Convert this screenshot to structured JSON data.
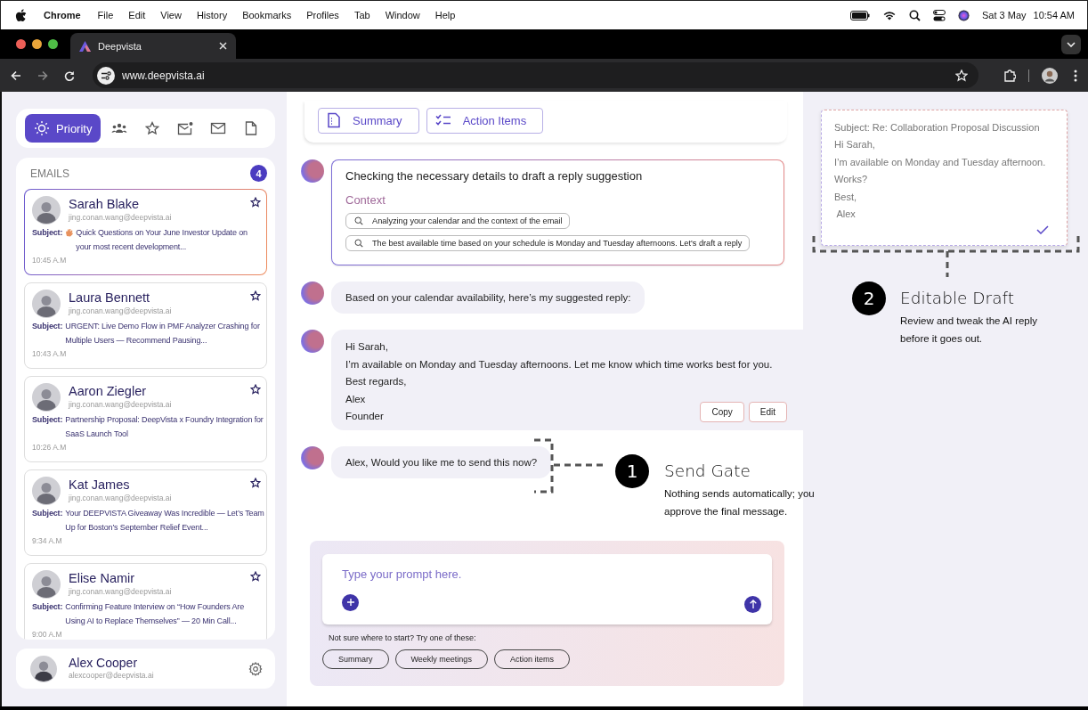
{
  "menu_bar": {
    "app": "Chrome",
    "items": [
      "File",
      "Edit",
      "View",
      "History",
      "Bookmarks",
      "Profiles",
      "Tab",
      "Window",
      "Help"
    ],
    "date": "Sat 3 May",
    "time": "10:54 AM"
  },
  "browser": {
    "tab_title": "Deepvista",
    "url": "www.deepvista.ai"
  },
  "sidebar": {
    "filters": [
      {
        "kind": "priority",
        "label": "Priority",
        "selected": true
      },
      {
        "kind": "people",
        "selected": false
      },
      {
        "kind": "star",
        "selected": false
      },
      {
        "kind": "mail_dot",
        "selected": false
      },
      {
        "kind": "mail",
        "selected": false
      },
      {
        "kind": "document",
        "selected": false
      }
    ],
    "emails_title": "EMAILS",
    "emails_count": "4",
    "emails": [
      {
        "name": "Sarah Blake",
        "address": "jing.conan.wang@deepvista.ai",
        "wave_emoji": true,
        "subject_label": "Subject:",
        "subject": "Quick Questions on Your June Investor Update on your most recent development...",
        "time": "10:45 A.M",
        "selected": true
      },
      {
        "name": "Laura Bennett",
        "address": "jing.conan.wang@deepvista.ai",
        "subject_label": "Subject:",
        "subject": "URGENT: Live Demo Flow in PMF Analyzer Crashing for Multiple Users — Recommend Pausing...",
        "time": "10:43 A.M",
        "selected": false
      },
      {
        "name": "Aaron Ziegler",
        "address": "jing.conan.wang@deepvista.ai",
        "subject_label": "Subject:",
        "subject": "Partnership Proposal: DeepVista x Foundry Integration for SaaS Launch Tool",
        "time": "10:26 A.M",
        "selected": false
      },
      {
        "name": "Kat James",
        "address": "jing.conan.wang@deepvista.ai",
        "subject_label": "Subject:",
        "subject": "Your DEEPVISTA Giveaway Was Incredible — Let’s Team Up for Boston’s September Relief Event...",
        "time": "9:34 A.M",
        "selected": false
      },
      {
        "name": "Elise Namir",
        "address": "jing.conan.wang@deepvista.ai",
        "subject_label": "Subject:",
        "subject": "Confirming Feature Interview on “How Founders Are Using AI to Replace Themselves” — 20 Min Call...",
        "time": "9:00 A.M",
        "selected": false
      }
    ],
    "user": {
      "name": "Alex Cooper",
      "address": "alexcooper@deepvista.ai"
    }
  },
  "quick_actions": [
    {
      "kind": "summary",
      "label": "Summary"
    },
    {
      "kind": "action_items",
      "label": "Action Items"
    }
  ],
  "messages": [
    {
      "kind": "context",
      "title": "Checking the necessary details to draft a reply suggestion",
      "context_label": "Context",
      "queries": [
        "Analyzing your calendar and the context of the email",
        "The best available time based on your schedule is Monday and Tuesday afternoons. Let's draft a reply"
      ]
    },
    {
      "kind": "text",
      "text": "Based on your calendar availability, here’s my suggested reply:"
    },
    {
      "kind": "draft",
      "lines": [
        "Hi Sarah,",
        "I’m available on Monday and Tuesday afternoons. Let me know which time works best for you.",
        "Best regards,",
        "Alex",
        "Founder"
      ],
      "buttons": [
        "Copy",
        "Edit"
      ]
    },
    {
      "kind": "text",
      "text": "Alex, Would you like me to send this now?"
    }
  ],
  "send_gate_note": {
    "number": "1",
    "title": "Send Gate",
    "text": "Nothing sends automatically; you approve the final message."
  },
  "composer": {
    "placeholder": "Type your prompt here.",
    "hint": "Not sure where to start? Try one of these:",
    "suggestions": [
      "Summary",
      "Weekly meetings",
      "Action items"
    ]
  },
  "draft_preview": {
    "lines": [
      "Subject: Re: Collaboration Proposal Discussion",
      "Hi Sarah,",
      "I’m available on Monday and Tuesday afternoon.",
      "Works?",
      "Best,",
      " Alex"
    ]
  },
  "draft_note": {
    "number": "2",
    "title": "Editable Draft",
    "text": "Review and tweak the AI reply before it goes out."
  }
}
